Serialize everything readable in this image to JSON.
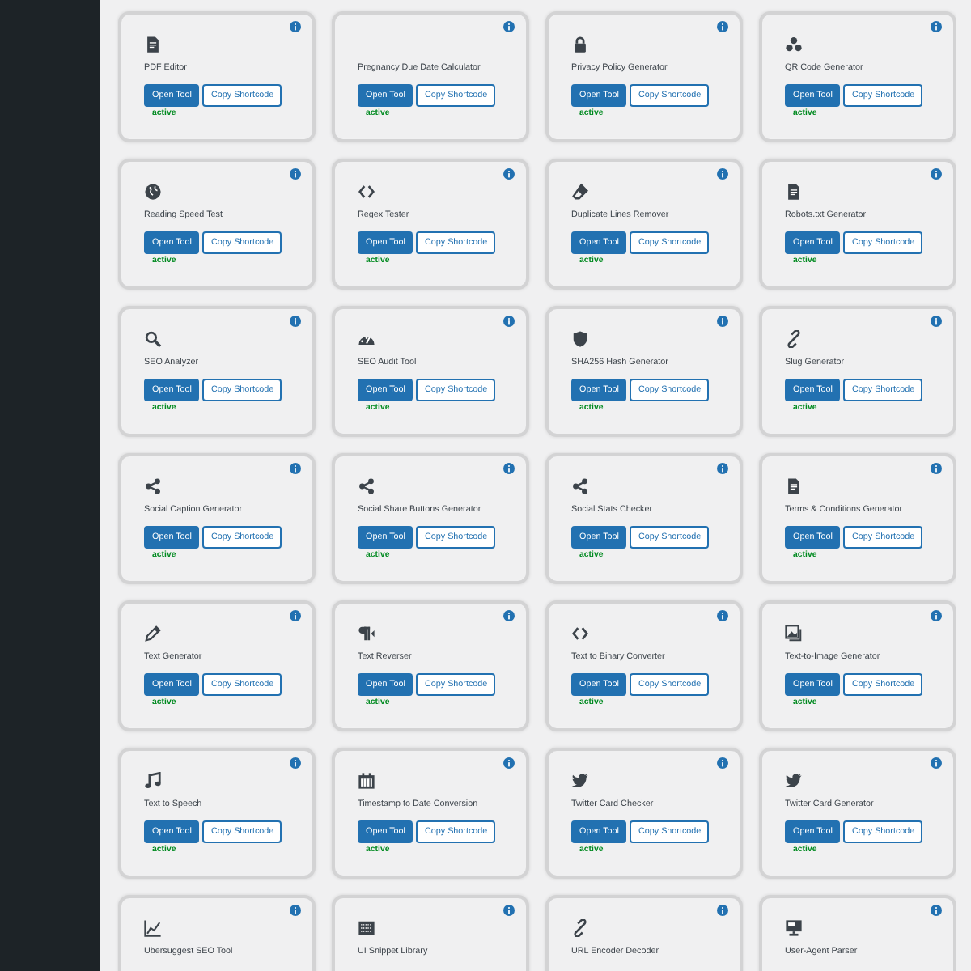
{
  "tools": [
    {
      "title": "PDF Editor",
      "buttons": [
        "Open Tool",
        "Copy Shortcode"
      ],
      "status": "active"
    },
    {
      "title": "Pregnancy Due Date Calculator",
      "buttons": [
        "Open Tool",
        "Copy Shortcode"
      ],
      "status": "active"
    },
    {
      "title": "Privacy Policy Generator",
      "buttons": [
        "Open Tool",
        "Copy Shortcode"
      ],
      "status": "active"
    },
    {
      "title": "QR Code Generator",
      "buttons": [
        "Open Tool",
        "Copy Shortcode"
      ],
      "status": "active"
    },
    {
      "title": "Reading Speed Test",
      "buttons": [
        "Open Tool",
        "Copy Shortcode"
      ],
      "status": "active"
    },
    {
      "title": "Regex Tester",
      "buttons": [
        "Open Tool",
        "Copy Shortcode"
      ],
      "status": "active"
    },
    {
      "title": "Duplicate Lines Remover",
      "buttons": [
        "Open Tool",
        "Copy Shortcode"
      ],
      "status": "active"
    },
    {
      "title": "Robots.txt Generator",
      "buttons": [
        "Open Tool",
        "Copy Shortcode"
      ],
      "status": "active"
    },
    {
      "title": "SEO Analyzer",
      "buttons": [
        "Open Tool",
        "Copy Shortcode"
      ],
      "status": "active"
    },
    {
      "title": "SEO Audit Tool",
      "buttons": [
        "Open Tool",
        "Copy Shortcode"
      ],
      "status": "active"
    },
    {
      "title": "SHA256 Hash Generator",
      "buttons": [
        "Open Tool",
        "Copy Shortcode"
      ],
      "status": "active"
    },
    {
      "title": "Slug Generator",
      "buttons": [
        "Open Tool",
        "Copy Shortcode"
      ],
      "status": "active"
    },
    {
      "title": "Social Caption Generator",
      "buttons": [
        "Open Tool",
        "Copy Shortcode"
      ],
      "status": "active"
    },
    {
      "title": "Social Share Buttons Generator",
      "buttons": [
        "Open Tool",
        "Copy Shortcode"
      ],
      "status": "active"
    },
    {
      "title": "Social Stats Checker",
      "buttons": [
        "Open Tool",
        "Copy Shortcode"
      ],
      "status": "active"
    },
    {
      "title": "Terms & Conditions Generator",
      "buttons": [
        "Open Tool",
        "Copy Shortcode"
      ],
      "status": "active"
    },
    {
      "title": "Text Generator",
      "buttons": [
        "Open Tool",
        "Copy Shortcode"
      ],
      "status": "active"
    },
    {
      "title": "Text Reverser",
      "buttons": [
        "Open Tool",
        "Copy Shortcode"
      ],
      "status": "active"
    },
    {
      "title": "Text to Binary Converter",
      "buttons": [
        "Open Tool",
        "Copy Shortcode"
      ],
      "status": "active"
    },
    {
      "title": "Text-to-Image Generator",
      "buttons": [
        "Open Tool",
        "Copy Shortcode"
      ],
      "status": "active"
    },
    {
      "title": "Text to Speech",
      "buttons": [
        "Open Tool",
        "Copy Shortcode"
      ],
      "status": "active"
    },
    {
      "title": "Timestamp to Date Conversion",
      "buttons": [
        "Open Tool",
        "Copy Shortcode"
      ],
      "status": "active"
    },
    {
      "title": "Twitter Card Checker",
      "buttons": [
        "Open Tool",
        "Copy Shortcode"
      ],
      "status": "active"
    },
    {
      "title": "Twitter Card Generator",
      "buttons": [
        "Open Tool",
        "Copy Shortcode"
      ],
      "status": "active"
    },
    {
      "title": "Ubersuggest SEO Tool"
    },
    {
      "title": "UI Snippet Library"
    },
    {
      "title": "URL Encoder Decoder"
    },
    {
      "title": "User-Agent Parser"
    }
  ]
}
